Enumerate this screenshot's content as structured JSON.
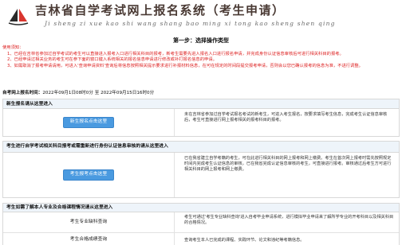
{
  "header": {
    "title": "吉林省自学考试网上报名系统（考生申请）",
    "pinyin": "Ji  sheng  zi  xue  kao  shi  wang  shang  bao  ming  xi  tong  kao  sheng  shen  qing"
  },
  "step_title": "第一步：选择操作类型",
  "notice": {
    "heading": "使用须知：",
    "items": [
      "1、已经在吉林省参加过自学考试的考生可以直接进入报考入口进行相关科目的报考，新考生需要先进入报名入口进行报名申请，并完成身份认证信息审核后可进行相关科目的报考。",
      "2、已经申请过相关业务的考生可在参下面的窗口键入系统相关的报名信息申请进行修改或补打报名信息的申请。",
      "3、如需取消了报考申请请用，可进入'查询申请资料'查询后将信息按照相关提示要求进行补报材料信息，在可在规定的时间段提交报考申请，否则会以您已确认报考的信息为准，不进行调整。"
    ]
  },
  "time": {
    "label": "自考网上报名时间：",
    "value": "2022年09月1日08时0分 至 2022年09月15日16时0分"
  },
  "section1": {
    "header": "新生报名请从这里进入",
    "button": "新生报名点击这里",
    "description": "未在吉林省参加过自学考试报名考试的新考生，可进入考生报名，按要求填写考生信息，完成考生认证信息审核后，考生可直接进行网上报考相关的报考科目的报考。"
  },
  "section2": {
    "header": "考生进行自学考试相关科目报考或需重新进行身份认证信息审核的请从这里进入",
    "button": "考生报考点击这里",
    "description": "已在我省建立自学考籍的考生，可在此进行相关科目的网上报考和网上缴费。考生在首次网上报考时需先按照规定时间内完成考生认证信息的审核，已在我省完成认证信息审核的考生，可直接进行报考。审核通过后考生方可进行相关科目的网上报考和网上缴费。"
  },
  "section3": {
    "header": "考生如需了解本人专业及合格课程情况请从这里进入",
    "rows": [
      {
        "label": "考生专业缺科查询",
        "description": "考生可通过'考生专业缺科查询'进入自考毕业申请系统，进行模拟毕业申请来了解所学专业的开考科目以及相关科目的合格情况。"
      },
      {
        "label": "考生合格成绩查询",
        "description": "查询考生本人已完成的课程、实践环节、论文和违纪等考籍信息。"
      }
    ]
  },
  "colors": {
    "accent": "#4a9ae0",
    "notice": "#dd2222",
    "section_header_bg": "#eef4fa"
  }
}
